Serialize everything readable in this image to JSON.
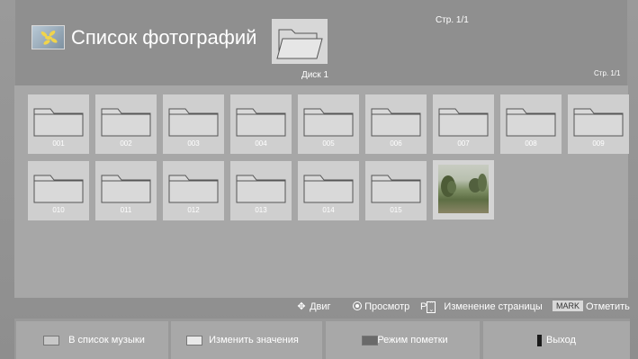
{
  "header": {
    "title": "Список фотографий",
    "disk": "Диск 1",
    "page_top": "Стр. 1/1",
    "page_right": "Стр. 1/1"
  },
  "folders": [
    "001",
    "002",
    "003",
    "004",
    "005",
    "006",
    "007",
    "008",
    "009",
    "010",
    "011",
    "012",
    "013",
    "014",
    "015"
  ],
  "hints": {
    "move": "Двиг",
    "view": "Просмотр",
    "page_prefix": "P",
    "page_change": "Изменение страницы",
    "mark_key": "MARK",
    "mark": "Отметить"
  },
  "buttons": [
    {
      "label": "В список музыки",
      "color": "#c8c8c8"
    },
    {
      "label": "Изменить значения",
      "color": "#e9e9e9"
    },
    {
      "label": "Режим пометки",
      "color": "#6a6a6a"
    },
    {
      "label": "Выход",
      "color": "#1a1a1a"
    }
  ]
}
